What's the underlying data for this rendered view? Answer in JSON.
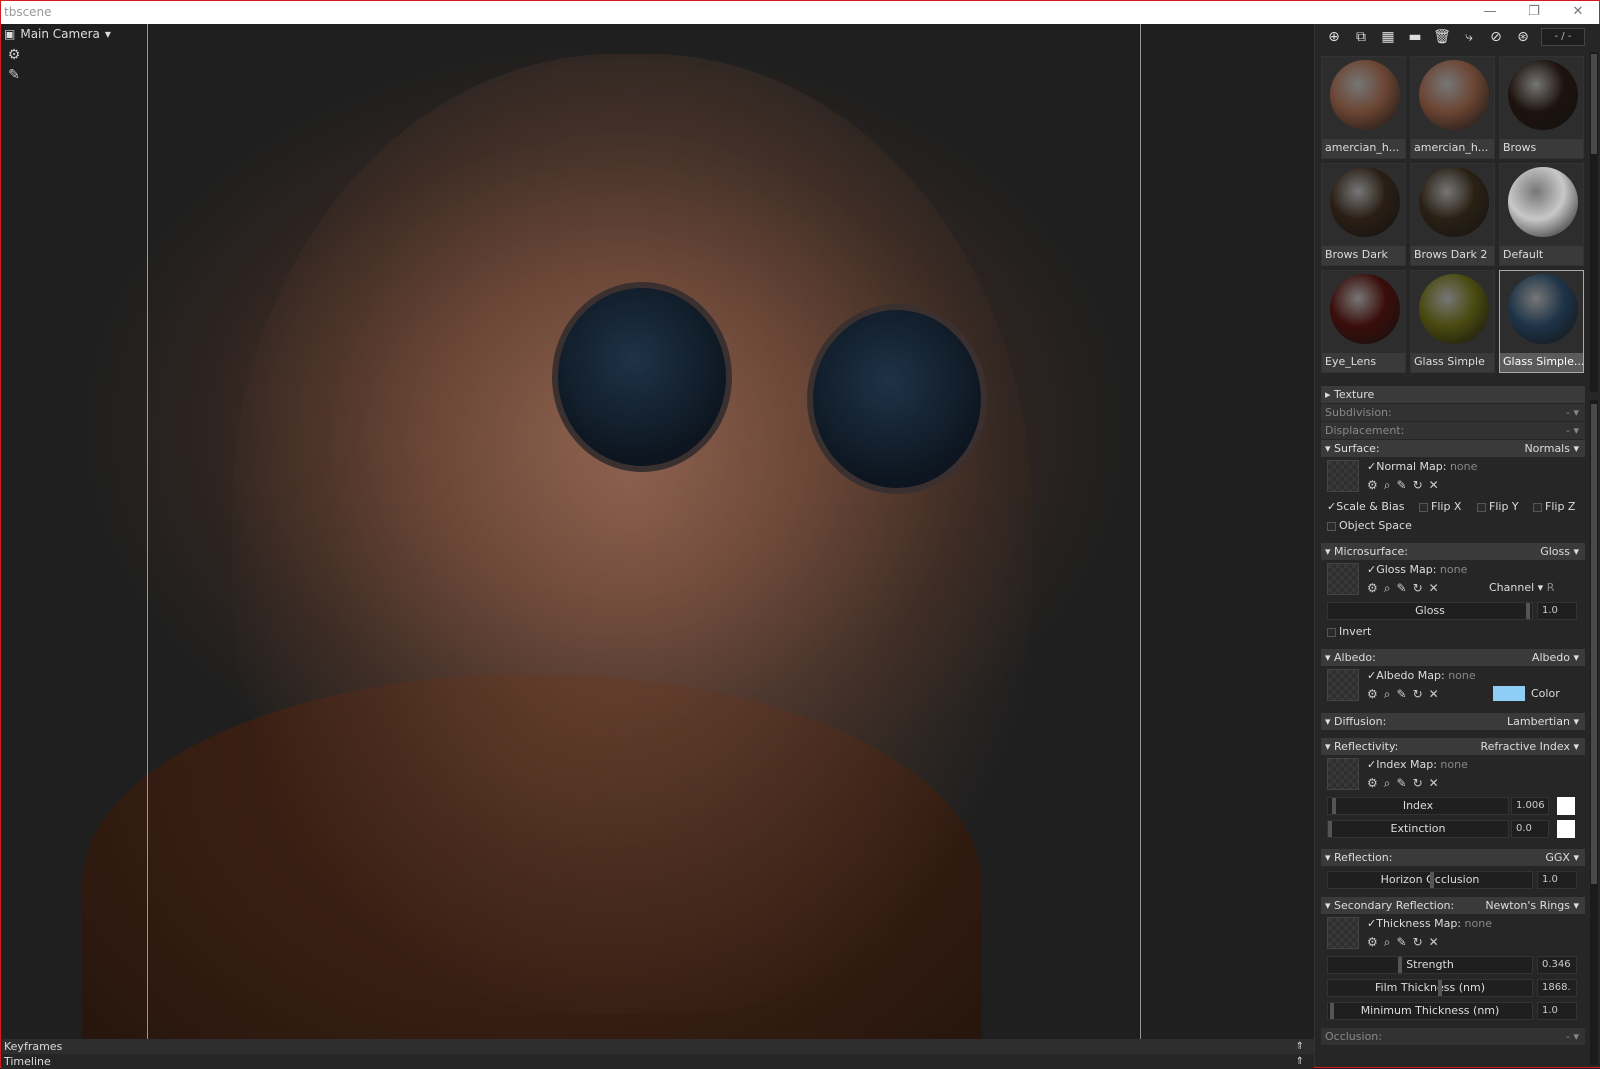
{
  "window": {
    "title": "tbscene"
  },
  "viewport": {
    "camera_label": "Main Camera"
  },
  "toolbar": {
    "page_indicator": "- / -"
  },
  "materials": [
    {
      "name": "amercian_h...",
      "color": "#6b4533"
    },
    {
      "name": "amercian_h...",
      "color": "#6b4533"
    },
    {
      "name": "Brows",
      "color": "#1e130e"
    },
    {
      "name": "Brows Dark",
      "color": "#2a1f15"
    },
    {
      "name": "Brows Dark 2",
      "color": "#2a2115"
    },
    {
      "name": "Default",
      "color": "#c8c8c8"
    },
    {
      "name": "Eye_Lens",
      "color": "#3a0e0a"
    },
    {
      "name": "Glass Simple",
      "color": "#4a4a10"
    },
    {
      "name": "Glass Simple...",
      "color": "#1e3448",
      "selected": true
    }
  ],
  "props": {
    "texture": "Texture",
    "subdivision": {
      "label": "Subdivision:",
      "value": "-"
    },
    "displacement": {
      "label": "Displacement:",
      "value": "-"
    },
    "surface": {
      "label": "Surface:",
      "value": "Normals",
      "map_label": "Normal Map:",
      "map_value": "none",
      "scale_bias": "Scale & Bias",
      "flip_x": "Flip X",
      "flip_y": "Flip Y",
      "flip_z": "Flip Z",
      "object_space": "Object Space"
    },
    "microsurface": {
      "label": "Microsurface:",
      "value": "Gloss",
      "map_label": "Gloss Map:",
      "map_value": "none",
      "channel_label": "Channel",
      "channel_value": "R",
      "slider_label": "Gloss",
      "slider_value": "1.0",
      "invert": "Invert"
    },
    "albedo": {
      "label": "Albedo:",
      "value": "Albedo",
      "map_label": "Albedo Map:",
      "map_value": "none",
      "color_label": "Color",
      "color": "#8ecdf6"
    },
    "diffusion": {
      "label": "Diffusion:",
      "value": "Lambertian"
    },
    "reflectivity": {
      "label": "Reflectivity:",
      "value": "Refractive Index",
      "map_label": "Index Map:",
      "map_value": "none",
      "index_label": "Index",
      "index_value": "1.006",
      "extinction_label": "Extinction",
      "extinction_value": "0.0"
    },
    "reflection": {
      "label": "Reflection:",
      "value": "GGX",
      "horizon_label": "Horizon Occlusion",
      "horizon_value": "1.0"
    },
    "secondary": {
      "label": "Secondary Reflection:",
      "value": "Newton's Rings",
      "map_label": "Thickness Map:",
      "map_value": "none",
      "strength_label": "Strength",
      "strength_value": "0.346",
      "film_label": "Film Thickness (nm)",
      "film_value": "1868.",
      "min_label": "Minimum Thickness (nm)",
      "min_value": "1.0"
    },
    "occlusion": {
      "label": "Occlusion:",
      "value": "-"
    }
  },
  "bottom": {
    "keyframes": "Keyframes",
    "timeline": "Timeline"
  }
}
